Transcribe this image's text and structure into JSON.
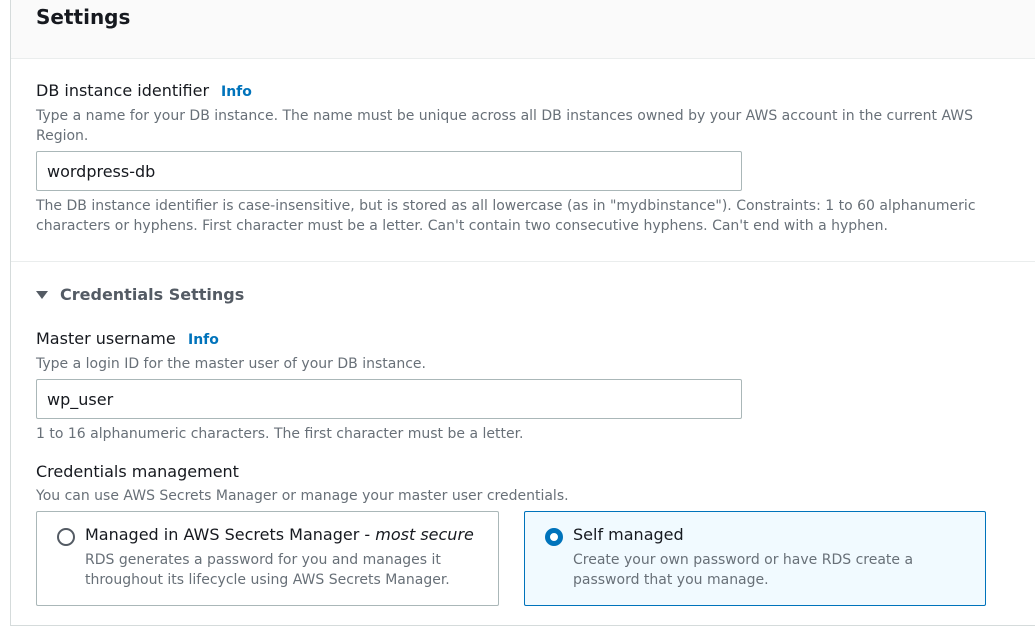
{
  "settings": {
    "title": "Settings"
  },
  "db_identifier": {
    "label": "DB instance identifier",
    "info": "Info",
    "description": "Type a name for your DB instance. The name must be unique across all DB instances owned by your AWS account in the current AWS Region.",
    "value": "wordpress-db",
    "constraints": "The DB instance identifier is case-insensitive, but is stored as all lowercase (as in \"mydbinstance\"). Constraints: 1 to 60 alphanumeric characters or hyphens. First character must be a letter. Can't contain two consecutive hyphens. Can't end with a hyphen."
  },
  "credentials": {
    "section_label": "Credentials Settings",
    "expanded": true,
    "master_username": {
      "label": "Master username",
      "info": "Info",
      "description": "Type a login ID for the master user of your DB instance.",
      "value": "wp_user",
      "constraints": "1 to 16 alphanumeric characters. The first character must be a letter."
    },
    "management": {
      "label": "Credentials management",
      "description": "You can use AWS Secrets Manager or manage your master user credentials.",
      "options": [
        {
          "title": "Managed in AWS Secrets Manager - ",
          "title_emphasis": "most secure",
          "description": "RDS generates a password for you and manages it throughout its lifecycle using AWS Secrets Manager.",
          "selected": false
        },
        {
          "title": "Self managed",
          "title_emphasis": "",
          "description": "Create your own password or have RDS create a password that you manage.",
          "selected": true
        }
      ]
    }
  },
  "colors": {
    "link": "#0073bb",
    "selected_tile_bg": "#f1faff",
    "selected_border": "#0073bb",
    "text_primary": "#16191f",
    "text_secondary": "#687078"
  }
}
